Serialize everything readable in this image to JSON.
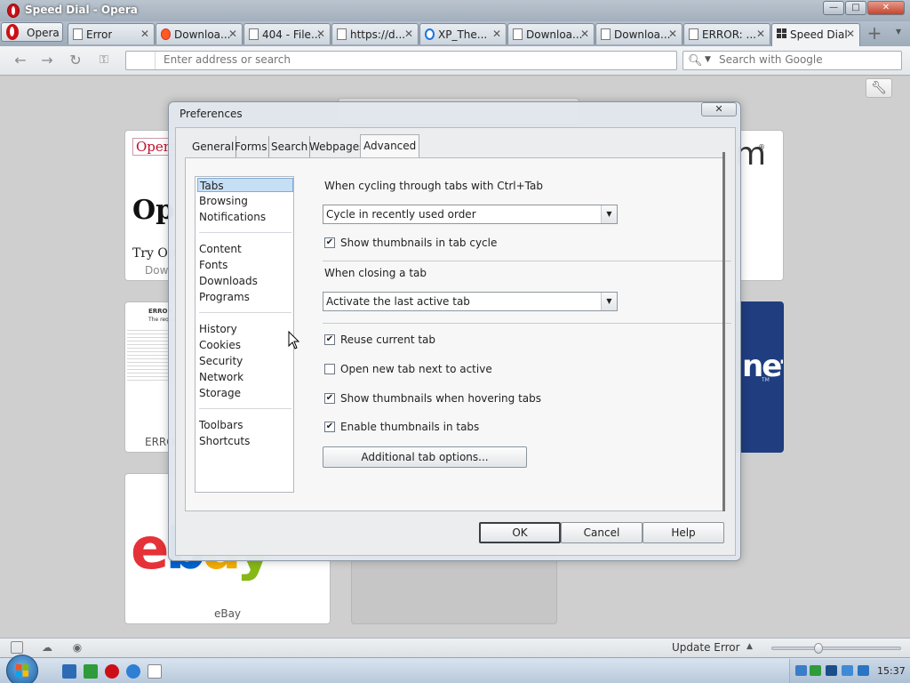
{
  "window": {
    "title": "Speed Dial - Opera",
    "controls": [
      "—",
      "□",
      "✕"
    ]
  },
  "opera_menu": {
    "label": "Opera"
  },
  "tabs": [
    {
      "label": "Error",
      "icon": "page-icon",
      "active": false
    },
    {
      "label": "Downloa...",
      "icon": "reddit-icon",
      "active": false
    },
    {
      "label": "404 - File...",
      "icon": "page-icon",
      "active": false
    },
    {
      "label": "https://d...",
      "icon": "page-icon",
      "active": false
    },
    {
      "label": "XP_The...",
      "icon": "xp-icon",
      "active": false
    },
    {
      "label": "Downloa...",
      "icon": "download-page-icon",
      "active": false
    },
    {
      "label": "Downloa...",
      "icon": "page-icon",
      "active": false
    },
    {
      "label": "ERROR: ...",
      "icon": "page-icon",
      "active": false
    },
    {
      "label": "Speed Dial",
      "icon": "speed-dial-icon",
      "active": true
    }
  ],
  "tab_close_glyph": "✕",
  "new_tab_glyph": "+",
  "address_bar": {
    "placeholder": "Enter address or search",
    "search_placeholder": "Search with Google"
  },
  "speed_dial": {
    "tiles": [
      {
        "caption": "Down",
        "brand": "Opera",
        "headline": "Ope",
        "tagline": "Try Op"
      },
      {
        "caption": "ERROR",
        "title": "ERROR",
        "subtitle": "The requeste"
      },
      {
        "caption": "eBay",
        "logo": [
          "e",
          "b",
          "a",
          "y"
        ]
      },
      {
        "caption": "",
        "text": "net",
        "tm": "TM"
      },
      {
        "caption": "",
        "text": "m",
        "reg": "®"
      }
    ]
  },
  "preferences": {
    "title": "Preferences",
    "close_glyph": "✕",
    "tabs": [
      "General",
      "Forms",
      "Search",
      "Webpages",
      "Advanced"
    ],
    "active_tab": "Advanced",
    "categories": [
      [
        "Tabs",
        "Browsing",
        "Notifications"
      ],
      [
        "Content",
        "Fonts",
        "Downloads",
        "Programs"
      ],
      [
        "History",
        "Cookies",
        "Security",
        "Network",
        "Storage"
      ],
      [
        "Toolbars",
        "Shortcuts"
      ]
    ],
    "selected_category": "Tabs",
    "cycle_label": "When cycling through tabs with Ctrl+Tab",
    "cycle_select": "Cycle in recently used order",
    "show_thumbs_cycle": {
      "label": "Show thumbnails in tab cycle",
      "checked": true
    },
    "closing_label": "When closing a tab",
    "closing_select": "Activate the last active tab",
    "options": [
      {
        "label": "Reuse current tab",
        "checked": true
      },
      {
        "label": "Open new tab next to active",
        "checked": false
      },
      {
        "label": "Show thumbnails when hovering tabs",
        "checked": true
      },
      {
        "label": "Enable thumbnails in tabs",
        "checked": true
      }
    ],
    "additional_button": "Additional tab options...",
    "ok": "OK",
    "cancel": "Cancel",
    "help": "Help"
  },
  "status_bar": {
    "update_text": "Update Error",
    "zoom_level": 0.35
  },
  "taskbar": {
    "clock": "15:37"
  },
  "colors": {
    "opera_red": "#cc0f16",
    "selection_blue": "#c7dff5",
    "dialog_bg": "#ecedee"
  }
}
